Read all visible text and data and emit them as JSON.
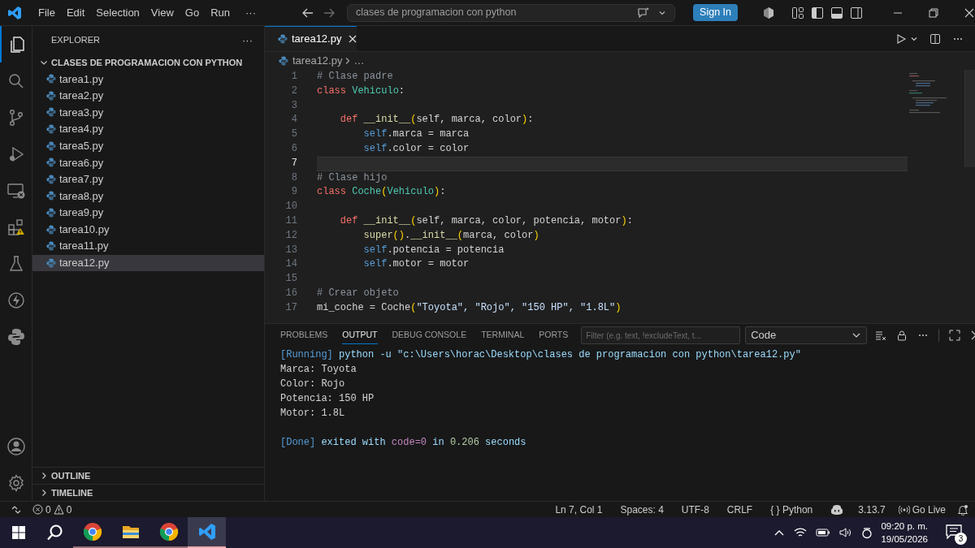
{
  "menu": [
    "File",
    "Edit",
    "Selection",
    "View",
    "Go",
    "Run"
  ],
  "menu_more": "···",
  "command_center": {
    "text": "clases de programacion con python"
  },
  "sign_in": "Sign In",
  "explorer": {
    "title": "EXPLORER",
    "more": "···",
    "folder": {
      "name": "CLASES DE PROGRAMACION CON PYTHON",
      "expanded": true,
      "children": [
        {
          "name": "tarea1.py",
          "selected": false
        },
        {
          "name": "tarea2.py",
          "selected": false
        },
        {
          "name": "tarea3.py",
          "selected": false
        },
        {
          "name": "tarea4.py",
          "selected": false
        },
        {
          "name": "tarea5.py",
          "selected": false
        },
        {
          "name": "tarea6.py",
          "selected": false
        },
        {
          "name": "tarea7.py",
          "selected": false
        },
        {
          "name": "tarea8.py",
          "selected": false
        },
        {
          "name": "tarea9.py",
          "selected": false
        },
        {
          "name": "tarea10.py",
          "selected": false
        },
        {
          "name": "tarea11.py",
          "selected": false
        },
        {
          "name": "tarea12.py",
          "selected": true
        }
      ]
    }
  },
  "sections": [
    {
      "name": "OUTLINE",
      "expanded": false
    },
    {
      "name": "TIMELINE",
      "expanded": false
    }
  ],
  "editor_tab": {
    "label": "tarea12.py",
    "selected": true
  },
  "breadcrumb": {
    "file": "tarea12.py",
    "rest": "…"
  },
  "code": [
    {
      "number": "1",
      "selected": false,
      "tokens": [
        {
          "text": "# Clase padre",
          "kind": "comment"
        }
      ]
    },
    {
      "number": "2",
      "selected": false,
      "tokens": [
        {
          "text": "class ",
          "kind": "keyword"
        },
        {
          "text": "Vehiculo",
          "kind": "type"
        },
        {
          "text": ":",
          "kind": "plain"
        }
      ],
      "children": [
        {
          "number": "3",
          "selected": false
        },
        {
          "number": "4",
          "selected": false,
          "tokens": [
            {
              "text": "def ",
              "kind": "keyword"
            },
            {
              "text": "__init__",
              "kind": "function"
            },
            {
              "text": "(",
              "kind": "bracket"
            },
            {
              "text": "self, marca, color",
              "kind": "plain"
            },
            {
              "text": ")",
              "kind": "bracket"
            },
            {
              "text": ":",
              "kind": "plain"
            }
          ],
          "children": [
            {
              "number": "5",
              "selected": false,
              "tokens": [
                {
                  "text": "self",
                  "kind": "self"
                },
                {
                  "text": ".marca = marca",
                  "kind": "plain"
                }
              ]
            },
            {
              "number": "6",
              "selected": false,
              "tokens": [
                {
                  "text": "self",
                  "kind": "self"
                },
                {
                  "text": ".color = color",
                  "kind": "plain"
                }
              ]
            }
          ]
        }
      ]
    },
    {
      "number": "7",
      "selected": true
    },
    {
      "number": "8",
      "selected": false,
      "tokens": [
        {
          "text": "# Clase hijo",
          "kind": "comment"
        }
      ]
    },
    {
      "number": "9",
      "selected": false,
      "tokens": [
        {
          "text": "class ",
          "kind": "keyword"
        },
        {
          "text": "Coche",
          "kind": "type"
        },
        {
          "text": "(",
          "kind": "bracket"
        },
        {
          "text": "Vehiculo",
          "kind": "type"
        },
        {
          "text": ")",
          "kind": "bracket"
        },
        {
          "text": ":",
          "kind": "plain"
        }
      ],
      "children": [
        {
          "number": "10",
          "selected": false
        },
        {
          "number": "11",
          "selected": false,
          "tokens": [
            {
              "text": "def ",
              "kind": "keyword"
            },
            {
              "text": "__init__",
              "kind": "function"
            },
            {
              "text": "(",
              "kind": "bracket"
            },
            {
              "text": "self, marca, color, potencia, motor",
              "kind": "plain"
            },
            {
              "text": ")",
              "kind": "bracket"
            },
            {
              "text": ":",
              "kind": "plain"
            }
          ],
          "children": [
            {
              "number": "12",
              "selected": false,
              "tokens": [
                {
                  "text": "super",
                  "kind": "function"
                },
                {
                  "text": "()",
                  "kind": "bracket"
                },
                {
                  "text": ".",
                  "kind": "plain"
                },
                {
                  "text": "__init__",
                  "kind": "function"
                },
                {
                  "text": "(",
                  "kind": "bracket"
                },
                {
                  "text": "marca, color",
                  "kind": "plain"
                },
                {
                  "text": ")",
                  "kind": "bracket"
                }
              ]
            },
            {
              "number": "13",
              "selected": false,
              "tokens": [
                {
                  "text": "self",
                  "kind": "self"
                },
                {
                  "text": ".potencia = potencia",
                  "kind": "plain"
                }
              ]
            },
            {
              "number": "14",
              "selected": false,
              "tokens": [
                {
                  "text": "self",
                  "kind": "self"
                },
                {
                  "text": ".motor = motor",
                  "kind": "plain"
                }
              ]
            }
          ]
        }
      ]
    },
    {
      "number": "15",
      "selected": false
    },
    {
      "number": "16",
      "selected": false,
      "tokens": [
        {
          "text": "# Crear objeto",
          "kind": "comment"
        }
      ]
    },
    {
      "number": "17",
      "selected": false,
      "tokens": [
        {
          "text": "mi_coche = Coche",
          "kind": "plain"
        },
        {
          "text": "(",
          "kind": "bracket"
        },
        {
          "text": "\"Toyota\", \"Rojo\", \"150 HP\", \"1.8L\"",
          "kind": "string"
        },
        {
          "text": ")",
          "kind": "bracket"
        }
      ]
    }
  ],
  "panel": {
    "tabs": [
      {
        "label": "PROBLEMS",
        "selected": false
      },
      {
        "label": "OUTPUT",
        "selected": true
      },
      {
        "label": "DEBUG CONSOLE",
        "selected": false
      },
      {
        "label": "TERMINAL",
        "selected": false
      },
      {
        "label": "PORTS",
        "selected": false
      }
    ],
    "filter": {
      "placeholder": "Filter (e.g. text, !excludeText, t..."
    },
    "channel": "Code",
    "output": [
      {
        "tokens": [
          {
            "text": "[Running]",
            "kind": "tag"
          },
          {
            "text": " python -u \"c:\\Users\\horac\\Desktop\\clases de programacion con python\\tarea12.py\"",
            "kind": "info"
          }
        ]
      },
      {
        "tokens": [
          {
            "text": "Marca: Toyota",
            "kind": "plain"
          }
        ]
      },
      {
        "tokens": [
          {
            "text": "Color: Rojo",
            "kind": "plain"
          }
        ]
      },
      {
        "tokens": [
          {
            "text": "Potencia: 150 HP",
            "kind": "plain"
          }
        ]
      },
      {
        "tokens": [
          {
            "text": "Motor: 1.8L",
            "kind": "plain"
          }
        ]
      },
      {
        "gap_before": true,
        "tokens": [
          {
            "text": "[Done]",
            "kind": "tag"
          },
          {
            "text": " exited with ",
            "kind": "info"
          },
          {
            "text": "code=0",
            "kind": "magenta"
          },
          {
            "text": " in ",
            "kind": "info"
          },
          {
            "text": "0.206",
            "kind": "number"
          },
          {
            "text": " seconds",
            "kind": "info"
          }
        ]
      }
    ]
  },
  "status_bar": {
    "errors": "0",
    "warnings": "0",
    "cursor": "Ln 7, Col 1",
    "indent": "Spaces: 4",
    "encoding": "UTF-8",
    "eol": "CRLF",
    "language_icon": "{ }",
    "language": "Python",
    "interpreter": "3.13.7",
    "live": "Go Live"
  },
  "taskbar": {
    "apps": [
      {
        "kind": "chrome",
        "active": false
      },
      {
        "kind": "folder",
        "active": false
      },
      {
        "kind": "chrome",
        "active": false
      },
      {
        "kind": "vscode",
        "active": true
      }
    ],
    "time": "09:20 p. m.",
    "date": "19/05/2026",
    "notifications": "3"
  }
}
